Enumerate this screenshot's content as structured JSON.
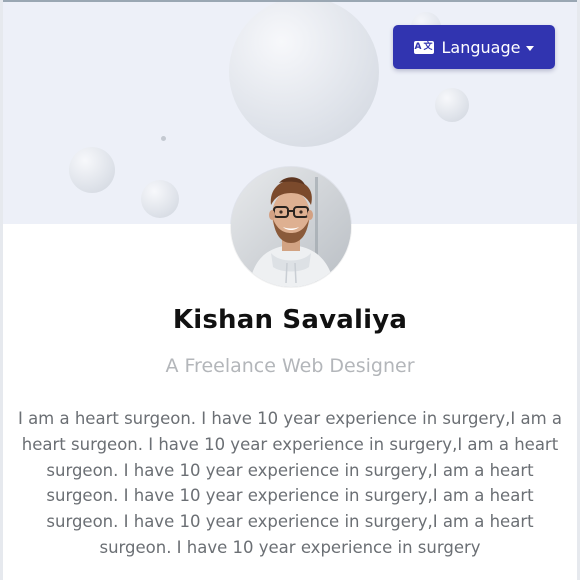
{
  "header": {
    "language_button_label": "Language",
    "language_icon": "translate-icon",
    "language_icon_text_left": "A",
    "language_icon_text_right": "文",
    "dropdown_icon": "caret-down-icon"
  },
  "profile": {
    "avatar_alt": "profile photo",
    "name": "Kishan Savaliya",
    "title": "A Freelance Web Designer",
    "bio": "I am a heart surgeon. I have 10 year experience in surgery,I am a heart surgeon. I have 10 year experience in surgery,I am a heart surgeon. I have 10 year experience in surgery,I am a heart surgeon. I have 10 year experience in surgery,I am a heart surgeon. I have 10 year experience in surgery,I am a heart surgeon. I have 10 year experience in surgery"
  },
  "colors": {
    "banner_bg": "#edf0f8",
    "button_bg": "#3134b0",
    "name_text": "#111111",
    "subtitle_text": "#b3b6ba",
    "bio_text": "#6b6f74"
  }
}
